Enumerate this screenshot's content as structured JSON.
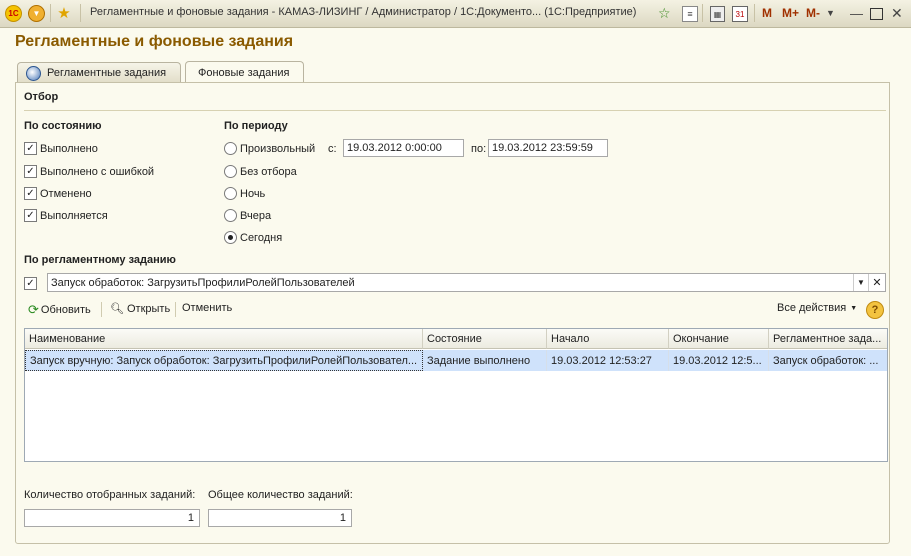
{
  "window": {
    "title": "Регламентные и фоновые задания - КАМАЗ-ЛИЗИНГ / Администратор /  1С:Документо...  (1С:Предприятие)",
    "logo": "1С",
    "m_buttons": [
      "M",
      "M+",
      "M-"
    ],
    "icons": [
      "1c-logo-icon",
      "dropdown-menu-icon",
      "favorite-star-icon",
      "add-favorite-icon",
      "history-icon",
      "calculator-icon",
      "calendar-icon",
      "minimize-icon",
      "maximize-icon",
      "close-icon"
    ]
  },
  "page": {
    "title": "Регламентные и фоновые задания"
  },
  "tabs": [
    {
      "label": "Регламентные задания",
      "active": false
    },
    {
      "label": "Фоновые задания",
      "active": true
    }
  ],
  "filter": {
    "title": "Отбор",
    "by_state": {
      "title": "По состоянию",
      "items": [
        {
          "label": "Выполнено",
          "checked": true
        },
        {
          "label": "Выполнено с ошибкой",
          "checked": true
        },
        {
          "label": "Отменено",
          "checked": true
        },
        {
          "label": "Выполняется",
          "checked": true
        }
      ]
    },
    "by_period": {
      "title": "По периоду",
      "options": [
        {
          "label": "Произвольный",
          "selected": false
        },
        {
          "label": "Без отбора",
          "selected": false
        },
        {
          "label": "Ночь",
          "selected": false
        },
        {
          "label": "Вчера",
          "selected": false
        },
        {
          "label": "Сегодня",
          "selected": true
        }
      ],
      "from_label": "с:",
      "from_value": "19.03.2012  0:00:00",
      "to_label": "по:",
      "to_value": "19.03.2012 23:59:59"
    },
    "by_job": {
      "title": "По регламентному заданию",
      "checked": true,
      "value": "Запуск обработок: ЗагрузитьПрофилиРолейПользователей"
    }
  },
  "toolbar": {
    "refresh": "Обновить",
    "open": "Открыть",
    "cancel": "Отменить",
    "all_actions": "Все действия",
    "help": "?"
  },
  "table": {
    "columns": [
      "Наименование",
      "Состояние",
      "Начало",
      "Окончание",
      "Регламентное зада..."
    ],
    "rows": [
      [
        "Запуск вручную: Запуск обработок: ЗагрузитьПрофилиРолейПользовател...",
        "Задание выполнено",
        "19.03.2012 12:53:27",
        "19.03.2012 12:5...",
        "Запуск обработок: ..."
      ]
    ]
  },
  "footer": {
    "selected_label": "Количество отобранных заданий:",
    "selected_value": "1",
    "total_label": "Общее количество заданий:",
    "total_value": "1"
  },
  "colors": {
    "heading": "#8a5a00",
    "selection": "#cfe2fb",
    "background": "#fbfaee"
  }
}
